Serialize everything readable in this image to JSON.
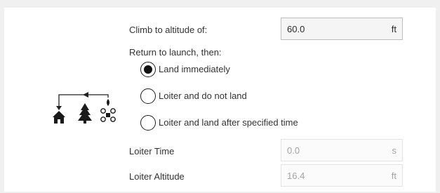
{
  "climb": {
    "label": "Climb to altitude of:",
    "value": "60.0",
    "unit": "ft"
  },
  "return": {
    "label": "Return to launch, then:",
    "options": [
      {
        "label": "Land immediately",
        "selected": true
      },
      {
        "label": "Loiter and do not land",
        "selected": false
      },
      {
        "label": "Loiter and land after specified time",
        "selected": false
      }
    ]
  },
  "loiter_time": {
    "label": "Loiter Time",
    "value": "0.0",
    "unit": "s"
  },
  "loiter_altitude": {
    "label": "Loiter Altitude",
    "value": "16.4",
    "unit": "ft"
  },
  "icons": [
    "home-icon",
    "tree-icon",
    "drone-icon",
    "arrow-left-icon"
  ],
  "colors": {
    "selected_dot": "#111111",
    "disabled_text": "#a3a3a3",
    "field_border": "#bdbdbd"
  }
}
